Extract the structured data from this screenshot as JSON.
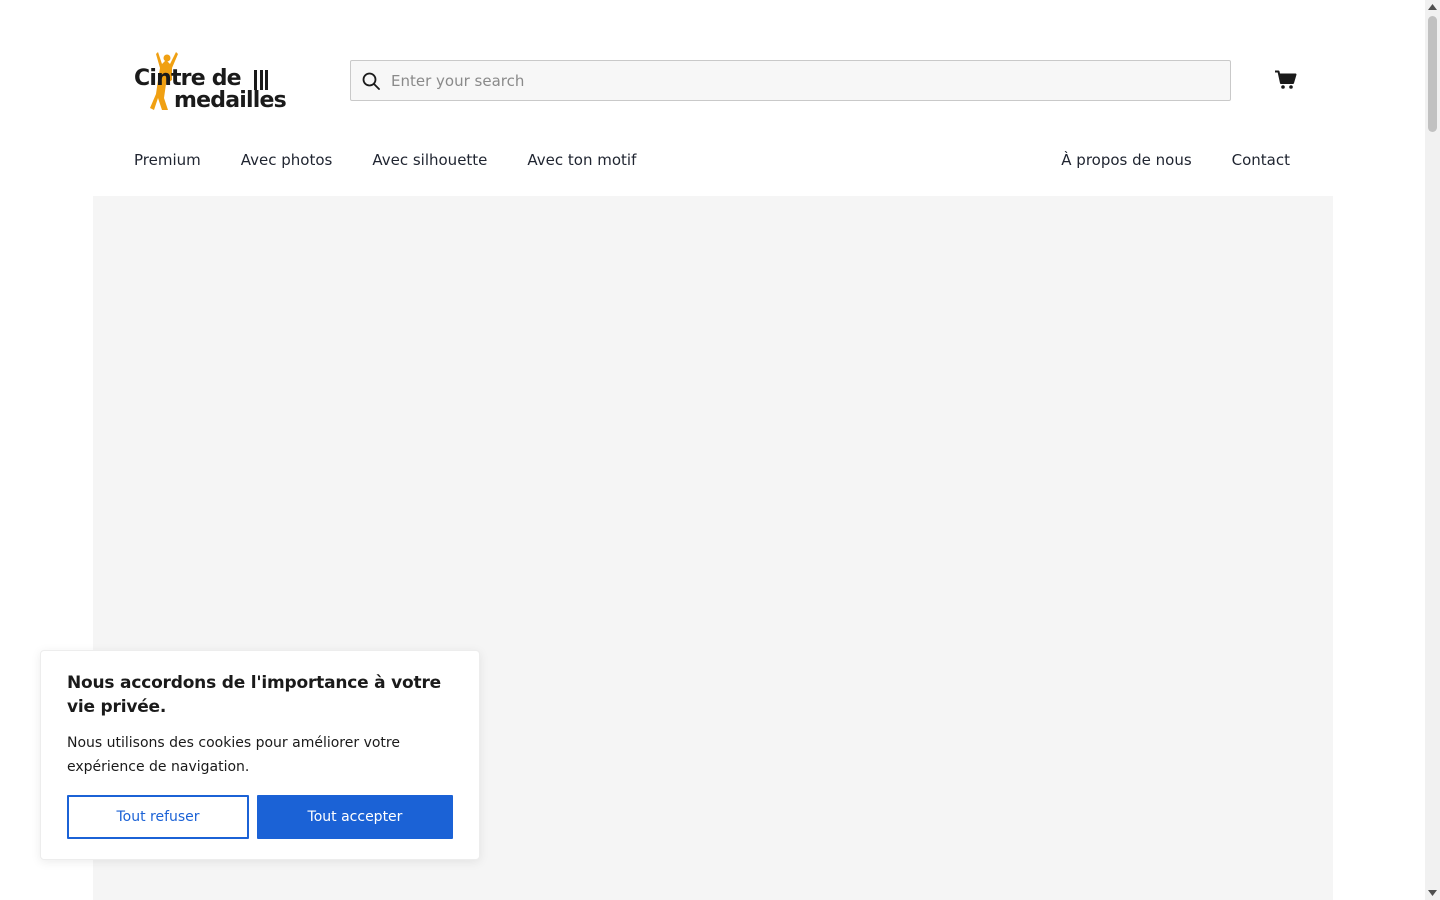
{
  "logo": {
    "line1": "Cintre de",
    "line2": "medailles",
    "accent_color": "#f0a012"
  },
  "search": {
    "placeholder": "Enter your search",
    "icon": "search-icon"
  },
  "cart": {
    "icon": "cart-icon"
  },
  "nav": {
    "left": [
      {
        "label": "Premium"
      },
      {
        "label": "Avec photos"
      },
      {
        "label": "Avec silhouette"
      },
      {
        "label": "Avec ton motif"
      }
    ],
    "right": [
      {
        "label": "À propos de nous"
      },
      {
        "label": "Contact"
      }
    ]
  },
  "cookie_banner": {
    "title": "Nous accordons de l'importance à votre vie privée.",
    "text": "Nous utilisons des cookies pour améliorer votre expérience de navigation.",
    "refuse_label": "Tout refuser",
    "accept_label": "Tout accepter",
    "accent_color": "#1b62d6"
  }
}
